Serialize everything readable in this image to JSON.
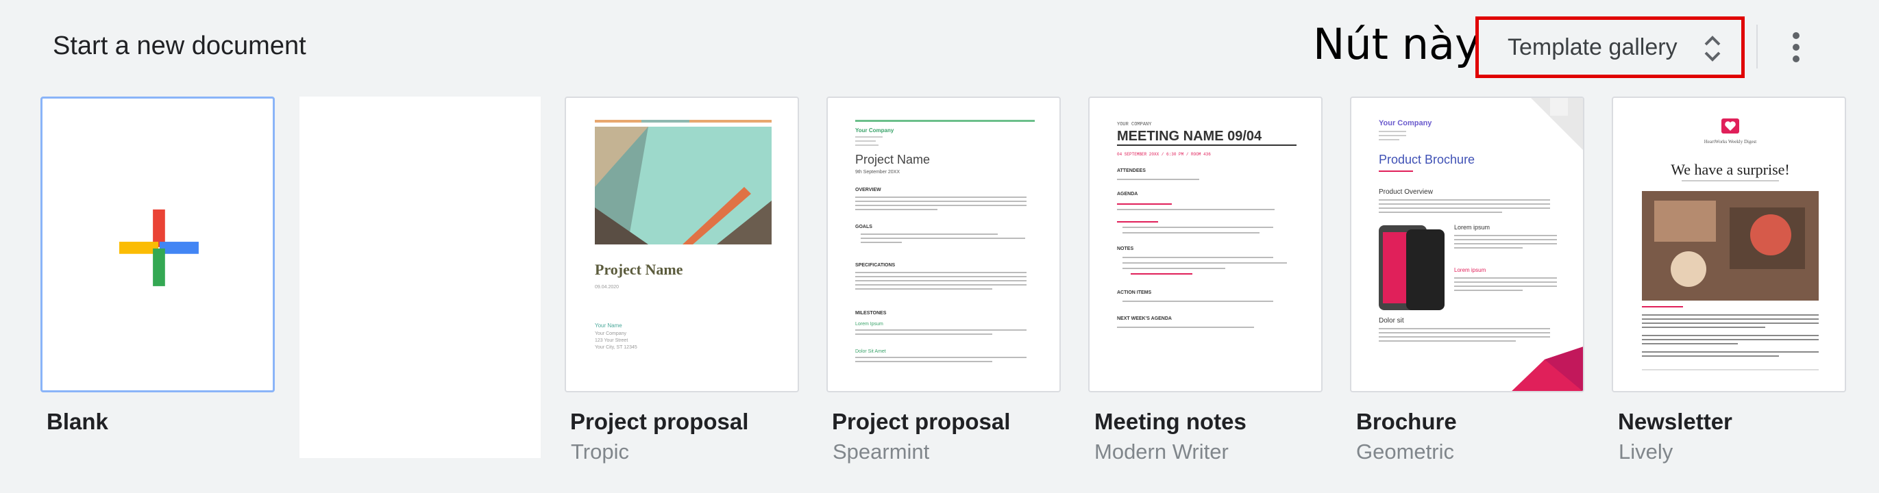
{
  "header": {
    "title": "Start a new document",
    "annotation": "Nút này",
    "gallery_label": "Template gallery"
  },
  "templates": [
    {
      "name": "Blank",
      "subtitle": ""
    },
    {
      "name": "Project proposal",
      "subtitle": "Tropic"
    },
    {
      "name": "Project proposal",
      "subtitle": "Spearmint"
    },
    {
      "name": "Meeting notes",
      "subtitle": "Modern Writer"
    },
    {
      "name": "Brochure",
      "subtitle": "Geometric"
    },
    {
      "name": "Newsletter",
      "subtitle": "Lively"
    }
  ],
  "thumbs": {
    "tropic": {
      "title": "Project Name",
      "date": "09.04.2020",
      "company": "Your Name",
      "lines": [
        "Your Company",
        "123 Your Street",
        "Your City, ST 12345"
      ]
    },
    "spearmint": {
      "company": "Your Company",
      "title": "Project Name",
      "date": "9th September 20XX",
      "h_overview": "OVERVIEW",
      "h_goals": "GOALS",
      "h_specs": "SPECIFICATIONS",
      "h_milestones": "MILESTONES",
      "m1": "Lorem Ipsum",
      "m2": "Dolor Sit Amet"
    },
    "writer": {
      "company": "YOUR COMPANY",
      "title": "MEETING NAME 09/04",
      "date": "04 SEPTEMBER 20XX / 6:30 PM / ROOM 436",
      "h_attendees": "ATTENDEES",
      "h_agenda": "AGENDA",
      "h_notes": "NOTES",
      "h_action": "ACTION ITEMS",
      "h_next": "NEXT WEEK'S AGENDA"
    },
    "geometric": {
      "company": "Your Company",
      "title": "Product Brochure",
      "h1": "Product Overview",
      "h2": "Lorem ipsum",
      "h3": "Lorem ipsum",
      "h4": "Dolor sit"
    },
    "lively": {
      "brand": "HeartWorks Weekly Digest",
      "title": "We have a surprise!"
    }
  },
  "colors": {
    "accent": "#1a73e8",
    "annotation_box": "#e00000",
    "plus_red": "#ea4335",
    "plus_yellow": "#fbbc04",
    "plus_blue": "#4285f4",
    "plus_green": "#34a853"
  }
}
